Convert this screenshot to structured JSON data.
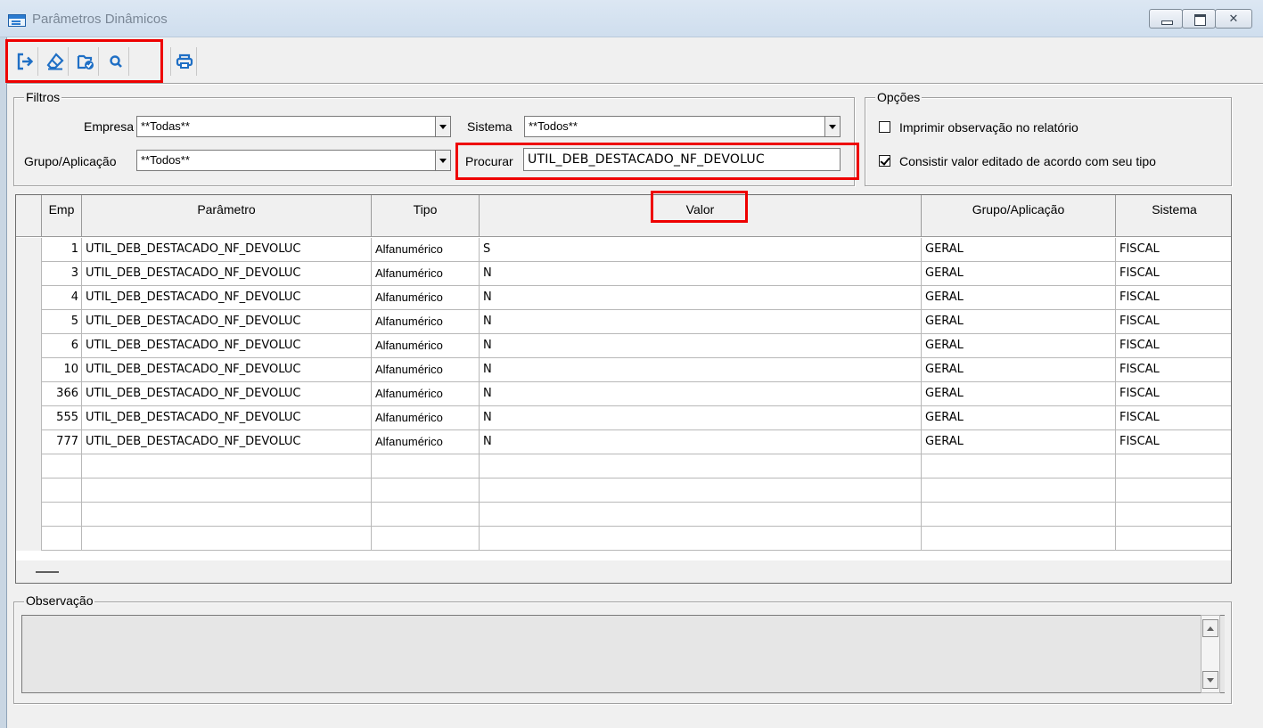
{
  "window": {
    "title": "Parâmetros Dinâmicos"
  },
  "toolbar": {
    "buttons": [
      {
        "name": "exit",
        "icon": "exit-arrow-icon"
      },
      {
        "name": "clear",
        "icon": "eraser-icon"
      },
      {
        "name": "confirm",
        "icon": "folder-check-icon"
      },
      {
        "name": "search",
        "icon": "magnifier-icon"
      },
      {
        "name": "print",
        "icon": "printer-icon"
      }
    ]
  },
  "filters": {
    "label": "Filtros",
    "empresa_label": "Empresa",
    "empresa_value": "**Todas**",
    "sistema_label": "Sistema",
    "sistema_value": "**Todos**",
    "grupo_label": "Grupo/Aplicação",
    "grupo_value": "**Todos**",
    "procurar_label": "Procurar",
    "procurar_value": "UTIL_DEB_DESTACADO_NF_DEVOLUC"
  },
  "options": {
    "label": "Opções",
    "imprimir_label": "Imprimir observação no relatório",
    "imprimir_checked": false,
    "consistir_label": "Consistir valor editado de acordo com seu tipo",
    "consistir_checked": true
  },
  "grid": {
    "columns": [
      "Emp",
      "Parâmetro",
      "Tipo",
      "Valor",
      "Grupo/Aplicação",
      "Sistema"
    ],
    "rows": [
      {
        "emp": "1",
        "parametro": "UTIL_DEB_DESTACADO_NF_DEVOLUC",
        "tipo": "Alfanumérico",
        "valor": "S",
        "grupo": "GERAL",
        "sistema": "FISCAL"
      },
      {
        "emp": "3",
        "parametro": "UTIL_DEB_DESTACADO_NF_DEVOLUC",
        "tipo": "Alfanumérico",
        "valor": "N",
        "grupo": "GERAL",
        "sistema": "FISCAL"
      },
      {
        "emp": "4",
        "parametro": "UTIL_DEB_DESTACADO_NF_DEVOLUC",
        "tipo": "Alfanumérico",
        "valor": "N",
        "grupo": "GERAL",
        "sistema": "FISCAL"
      },
      {
        "emp": "5",
        "parametro": "UTIL_DEB_DESTACADO_NF_DEVOLUC",
        "tipo": "Alfanumérico",
        "valor": "N",
        "grupo": "GERAL",
        "sistema": "FISCAL"
      },
      {
        "emp": "6",
        "parametro": "UTIL_DEB_DESTACADO_NF_DEVOLUC",
        "tipo": "Alfanumérico",
        "valor": "N",
        "grupo": "GERAL",
        "sistema": "FISCAL"
      },
      {
        "emp": "10",
        "parametro": "UTIL_DEB_DESTACADO_NF_DEVOLUC",
        "tipo": "Alfanumérico",
        "valor": "N",
        "grupo": "GERAL",
        "sistema": "FISCAL"
      },
      {
        "emp": "366",
        "parametro": "UTIL_DEB_DESTACADO_NF_DEVOLUC",
        "tipo": "Alfanumérico",
        "valor": "N",
        "grupo": "GERAL",
        "sistema": "FISCAL"
      },
      {
        "emp": "555",
        "parametro": "UTIL_DEB_DESTACADO_NF_DEVOLUC",
        "tipo": "Alfanumérico",
        "valor": "N",
        "grupo": "GERAL",
        "sistema": "FISCAL"
      },
      {
        "emp": "777",
        "parametro": "UTIL_DEB_DESTACADO_NF_DEVOLUC",
        "tipo": "Alfanumérico",
        "valor": "N",
        "grupo": "GERAL",
        "sistema": "FISCAL"
      }
    ]
  },
  "observacao": {
    "label": "Observação",
    "value": ""
  },
  "colors": {
    "highlight": "#ee0000",
    "title_text": "#7a8796"
  }
}
